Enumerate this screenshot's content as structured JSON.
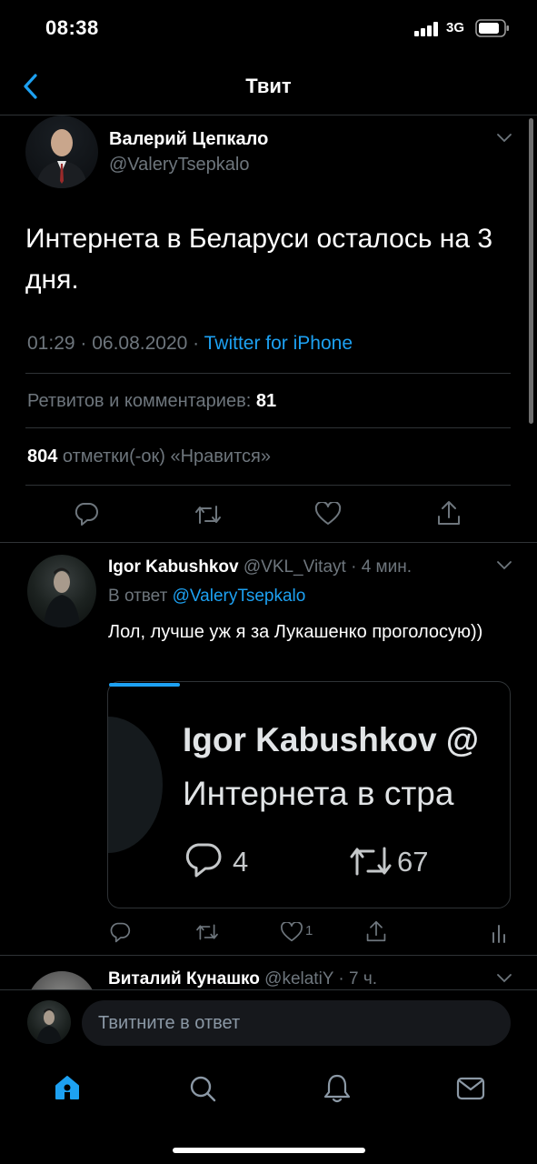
{
  "status_bar": {
    "time": "08:38",
    "network": "3G"
  },
  "header": {
    "title": "Твит"
  },
  "tweet": {
    "author_name": "Валерий Цепкало",
    "author_handle": "@ValeryTsepkalo",
    "text": "Интернета в Беларуси осталось на 3 дня.",
    "time": "01:29 · 06.08.2020 · ",
    "source": "Twitter for iPhone",
    "retweets_label": "Ретвитов и комментариев: ",
    "retweets_count": "81",
    "likes_count": "804",
    "likes_label": " отметки(-ок) «Нравится»"
  },
  "replies": [
    {
      "author_name": "Igor Kabushkov",
      "author_handle": " @VKL_Vitayt",
      "time": " · 4 мин.",
      "reply_to_label": "В ответ ",
      "reply_to_handle": "@ValeryTsepkalo",
      "text": "Лол, лучше уж я за Лукашенко проголосую))",
      "media": {
        "name": "Igor Kabushkov @",
        "text": "Интернета в стра",
        "replies": "4",
        "retweets": "67"
      },
      "like_count": "1"
    },
    {
      "author_name": "Виталий Кунашко",
      "author_handle": " @kelatiY",
      "time": " · 7 ч."
    }
  ],
  "composer": {
    "placeholder": "Твитните в ответ"
  },
  "nav": {
    "items": [
      "home-icon",
      "search-icon",
      "notifications-icon",
      "messages-icon"
    ]
  },
  "colors": {
    "accent": "#1da1f2",
    "background": "#000000",
    "secondary_text": "#6e767d",
    "divider": "#2f3336"
  }
}
